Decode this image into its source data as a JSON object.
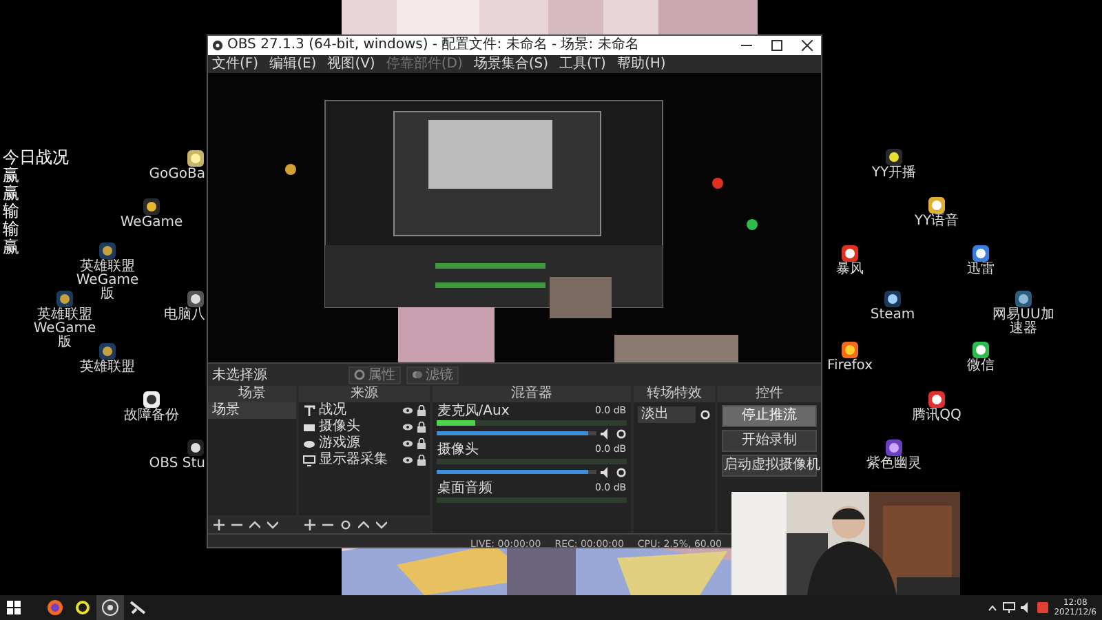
{
  "desktop": {
    "overlay": {
      "title": "今日战况",
      "results": [
        "赢",
        "赢",
        "输",
        "输",
        "赢"
      ]
    },
    "icons": [
      {
        "label": "GoGoBa"
      },
      {
        "label": "WeGame"
      },
      {
        "label": "英雄联盟 WeGame版"
      },
      {
        "label": "英雄联盟 WeGame版"
      },
      {
        "label": "英雄联盟"
      },
      {
        "label": "电脑八"
      },
      {
        "label": "故障备份"
      },
      {
        "label": "OBS Stu"
      },
      {
        "label": "YY开播"
      },
      {
        "label": "YY语音"
      },
      {
        "label": "暴风"
      },
      {
        "label": "迅雷"
      },
      {
        "label": "Steam"
      },
      {
        "label": "网易UU加速器"
      },
      {
        "label": "Firefox"
      },
      {
        "label": "微信"
      },
      {
        "label": "腾讯QQ"
      },
      {
        "label": "紫色幽灵"
      }
    ]
  },
  "obs": {
    "title": "OBS 27.1.3 (64-bit, windows) - 配置文件: 未命名 - 场景: 未命名",
    "menu": [
      {
        "label": "文件(F)",
        "disabled": false
      },
      {
        "label": "编辑(E)",
        "disabled": false
      },
      {
        "label": "视图(V)",
        "disabled": false
      },
      {
        "label": "停靠部件(D)",
        "disabled": true
      },
      {
        "label": "场景集合(S)",
        "disabled": false
      },
      {
        "label": "工具(T)",
        "disabled": false
      },
      {
        "label": "帮助(H)",
        "disabled": false
      }
    ],
    "source_bar": {
      "status": "未选择源",
      "buttons": [
        {
          "label": "属性",
          "kind": "gear"
        },
        {
          "label": "滤镜",
          "kind": "filter"
        }
      ]
    },
    "scenes": {
      "title": "场景",
      "items": [
        {
          "label": "场景",
          "selected": true
        }
      ]
    },
    "sources": {
      "title": "来源",
      "items": [
        {
          "label": "战况",
          "kind": "text"
        },
        {
          "label": "摄像头",
          "kind": "camera"
        },
        {
          "label": "游戏源",
          "kind": "game"
        },
        {
          "label": "显示器采集",
          "kind": "monitor"
        }
      ]
    },
    "mixer": {
      "title": "混音器",
      "channels": [
        {
          "name": "麦克风/Aux",
          "reading": "0.0 dB",
          "meter": {
            "level": 0.2
          },
          "volume": {
            "level": 0.95
          }
        },
        {
          "name": "摄像头",
          "reading": "0.0 dB",
          "volume": {
            "level": 0.95
          }
        },
        {
          "name": "桌面音频",
          "reading": "0.0 dB"
        }
      ]
    },
    "transitions": {
      "title": "转场特效",
      "value": "淡出"
    },
    "controls": {
      "title": "控件",
      "buttons": [
        {
          "label": "停止推流",
          "hovered": true
        },
        {
          "label": "开始录制",
          "hovered": false
        },
        {
          "label": "启动虚拟摄像机",
          "hovered": false
        }
      ]
    },
    "status_bar": {
      "live": "LIVE: 00:00:00",
      "rec": "REC: 00:00:00",
      "cpu": "CPU: 2.5%, 60.00"
    }
  },
  "taskbar": {
    "apps": [
      {
        "kind": "firefox",
        "active": false
      },
      {
        "kind": "yy",
        "active": false
      },
      {
        "kind": "obs",
        "active": true
      },
      {
        "kind": "tool",
        "active": false
      }
    ],
    "time": "12:08",
    "date": "2021/12/6"
  }
}
